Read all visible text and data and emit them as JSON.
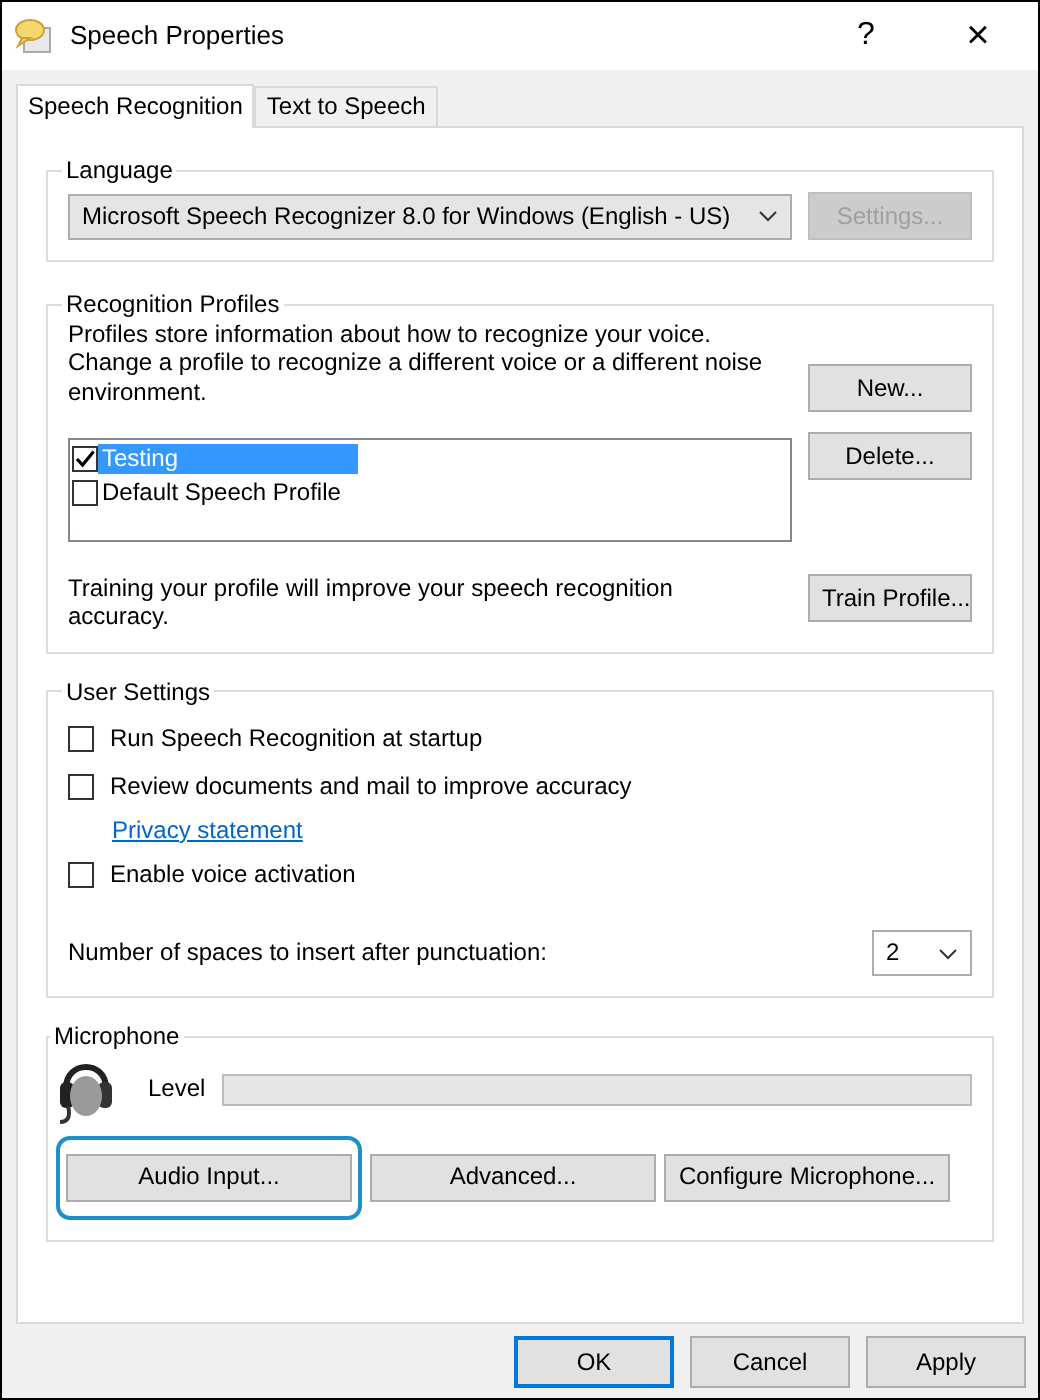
{
  "window": {
    "title": "Speech Properties",
    "help": "?",
    "close": "×"
  },
  "tabs": [
    {
      "label": "Speech Recognition",
      "selected": true
    },
    {
      "label": "Text to Speech",
      "selected": false
    }
  ],
  "language": {
    "label": "Language",
    "recognizer": "Microsoft Speech Recognizer 8.0 for Windows (English - US)",
    "settings_button": {
      "label": "Settings...",
      "disabled": true
    }
  },
  "recognition_profiles": {
    "label": "Recognition Profiles",
    "description": "Profiles store information about how to recognize your voice. Change a profile to recognize a different voice or a different noise environment.",
    "profiles": [
      {
        "name": "Testing",
        "checked": true,
        "selected": true
      },
      {
        "name": "Default Speech Profile",
        "checked": false,
        "selected": false
      }
    ],
    "buttons": [
      {
        "label": "New..."
      },
      {
        "label": "Delete..."
      }
    ],
    "training_note": "Training your profile will improve your speech recognition accuracy.",
    "train_button": "Train Profile..."
  },
  "user_settings": {
    "label": "User Settings",
    "options": [
      {
        "kind": "checkbox",
        "label": "Run Speech Recognition at startup",
        "checked": false
      },
      {
        "kind": "checkbox",
        "label": "Review documents and mail to improve accuracy",
        "checked": false
      },
      {
        "kind": "link",
        "label": "Privacy statement"
      },
      {
        "kind": "checkbox",
        "label": "Enable voice activation",
        "checked": false
      }
    ],
    "spaces_label": "Number of spaces to insert after punctuation:",
    "spaces_value": "2"
  },
  "microphone": {
    "label": "Microphone",
    "level_label": "Level",
    "buttons": [
      {
        "label": "Audio Input...",
        "highlighted": true
      },
      {
        "label": "Advanced...",
        "highlighted": false
      },
      {
        "label": "Configure Microphone...",
        "highlighted": false
      }
    ]
  },
  "footer_buttons": [
    {
      "label": "OK",
      "default": true
    },
    {
      "label": "Cancel",
      "default": false
    },
    {
      "label": "Apply",
      "default": false
    }
  ]
}
